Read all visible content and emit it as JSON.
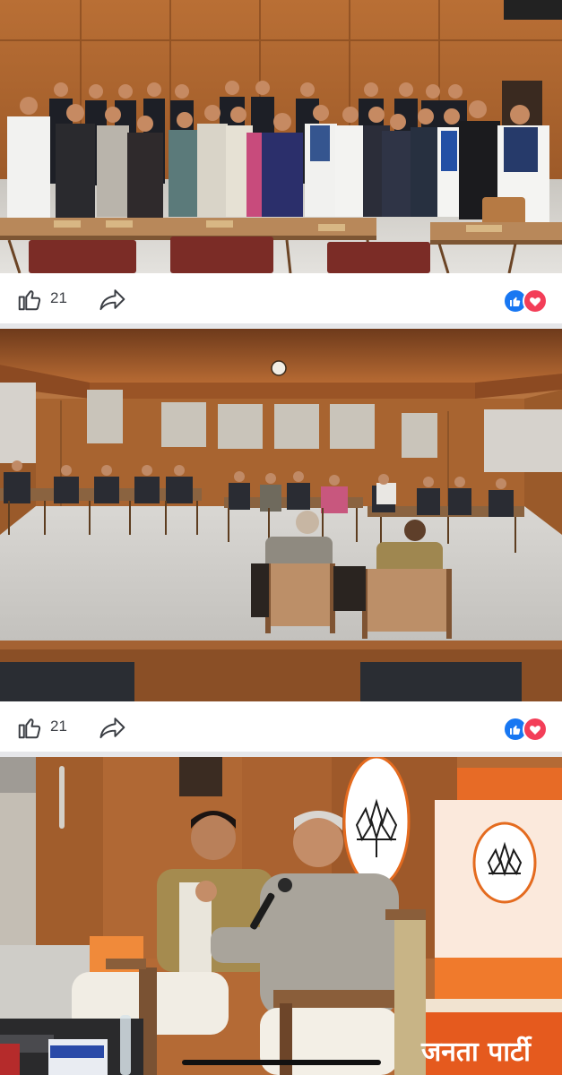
{
  "posts": [
    {
      "image_alt": "Group photo of delegation standing behind conference tables",
      "like_count": "21"
    },
    {
      "image_alt": "Wide view of meeting hall with delegates seated at tables",
      "like_count": "21"
    },
    {
      "image_alt": "Two speakers seated in front of party emblem banners"
    }
  ],
  "icons": {
    "like": "thumbs-up-icon",
    "share": "share-arrow-icon",
    "reactions": [
      "like-reaction-icon",
      "love-reaction-icon"
    ]
  },
  "colors": {
    "like_reaction": "#1877f2",
    "love_reaction": "#f33e58",
    "separator": "#e6e7ea",
    "wood": "#a15d2c"
  },
  "photo3": {
    "banner_text": "जनता पार्टी"
  }
}
